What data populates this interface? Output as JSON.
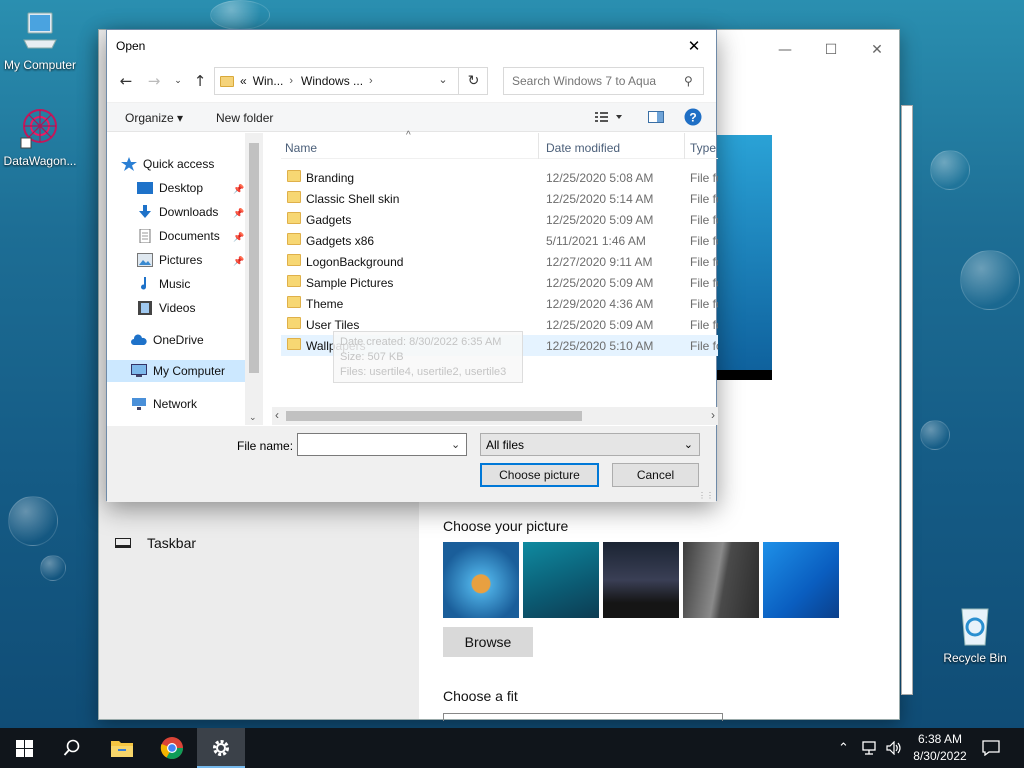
{
  "desktop": {
    "icons": [
      {
        "label": "My Computer"
      },
      {
        "label": "DataWagon..."
      },
      {
        "label": "Recycle Bin"
      }
    ]
  },
  "settings": {
    "nav_taskbar": "Taskbar",
    "choose_picture_heading": "Choose your picture",
    "browse_label": "Browse",
    "choose_fit_heading": "Choose a fit",
    "minimize_icon": "minimize-icon",
    "maximize_icon": "maximize-icon",
    "close_icon": "close-icon"
  },
  "dialog": {
    "title": "Open",
    "breadcrumb": {
      "overflow": "«",
      "items": [
        "Win...",
        "Windows ..."
      ]
    },
    "search_placeholder": "Search Windows 7 to Aqua",
    "toolbar": {
      "organize": "Organize",
      "new_folder": "New folder"
    },
    "nav": [
      {
        "label": "Quick access",
        "pinned": false
      },
      {
        "label": "Desktop",
        "pinned": true
      },
      {
        "label": "Downloads",
        "pinned": true
      },
      {
        "label": "Documents",
        "pinned": true
      },
      {
        "label": "Pictures",
        "pinned": true
      },
      {
        "label": "Music",
        "pinned": false
      },
      {
        "label": "Videos",
        "pinned": false
      },
      {
        "label": "OneDrive",
        "pinned": false
      },
      {
        "label": "My Computer",
        "pinned": false,
        "selected": true
      },
      {
        "label": "Network",
        "pinned": false
      }
    ],
    "columns": {
      "name": "Name",
      "date": "Date modified",
      "type": "Type"
    },
    "files": [
      {
        "name": "Branding",
        "date": "12/25/2020 5:08 AM",
        "type": "File fo"
      },
      {
        "name": "Classic Shell skin",
        "date": "12/25/2020 5:14 AM",
        "type": "File fo"
      },
      {
        "name": "Gadgets",
        "date": "12/25/2020 5:09 AM",
        "type": "File fo"
      },
      {
        "name": "Gadgets x86",
        "date": "5/11/2021 1:46 AM",
        "type": "File fo"
      },
      {
        "name": "LogonBackground",
        "date": "12/27/2020 9:11 AM",
        "type": "File fo"
      },
      {
        "name": "Sample Pictures",
        "date": "12/25/2020 5:09 AM",
        "type": "File fo"
      },
      {
        "name": "Theme",
        "date": "12/29/2020 4:36 AM",
        "type": "File fo"
      },
      {
        "name": "User Tiles",
        "date": "12/25/2020 5:09 AM",
        "type": "File fo"
      },
      {
        "name": "Wallpapers",
        "date": "12/25/2020 5:10 AM",
        "type": "File fo",
        "hovered": true
      }
    ],
    "tooltip": {
      "line1": "Date created: 8/30/2022 6:35 AM",
      "line2": "Size: 507 KB",
      "line3": "Files: usertile4, usertile2, usertile3"
    },
    "file_name_label": "File name:",
    "file_name_value": "",
    "filter_value": "All files",
    "choose_button": "Choose picture",
    "cancel_button": "Cancel"
  },
  "taskbar": {
    "time": "6:38 AM",
    "date": "8/30/2022"
  },
  "colors": {
    "accent": "#0078d7",
    "selection": "#cce8ff",
    "hover_row": "#e5f3ff",
    "taskbar": "#10151b",
    "folder": "#f7d773"
  }
}
